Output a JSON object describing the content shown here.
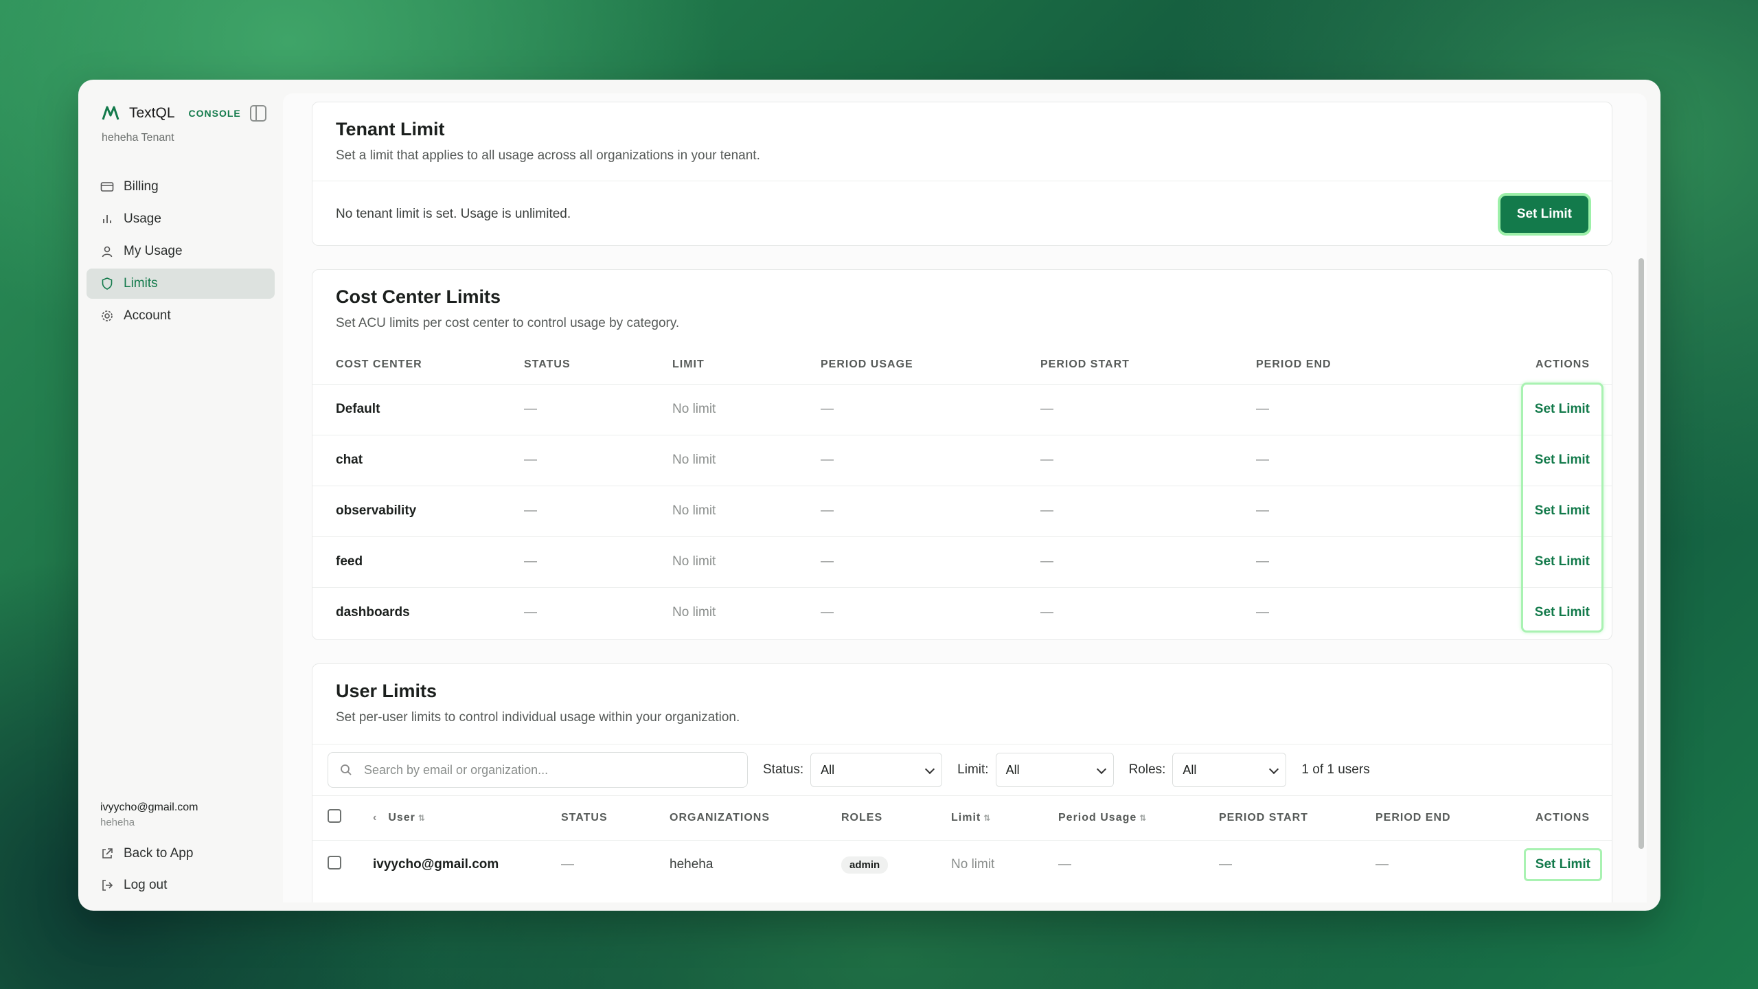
{
  "sidebar": {
    "brand": "TextQL",
    "console": "CONSOLE",
    "tenant": "heheha Tenant",
    "nav": [
      {
        "label": "Billing",
        "icon": "credit-card-icon"
      },
      {
        "label": "Usage",
        "icon": "bar-chart-icon"
      },
      {
        "label": "My Usage",
        "icon": "user-icon"
      },
      {
        "label": "Limits",
        "icon": "shield-icon",
        "active": true
      },
      {
        "label": "Account",
        "icon": "gear-icon"
      }
    ],
    "user_email": "ivyycho@gmail.com",
    "user_org": "heheha",
    "back_to_app": "Back to App",
    "logout": "Log out"
  },
  "tenant_limit": {
    "title": "Tenant Limit",
    "subtitle": "Set a limit that applies to all usage across all organizations in your tenant.",
    "status": "No tenant limit is set. Usage is unlimited.",
    "button": "Set Limit"
  },
  "cost_center": {
    "title": "Cost Center Limits",
    "subtitle": "Set ACU limits per cost center to control usage by category.",
    "headers": [
      "COST CENTER",
      "STATUS",
      "LIMIT",
      "PERIOD USAGE",
      "PERIOD START",
      "PERIOD END",
      "ACTIONS"
    ],
    "rows": [
      {
        "name": "Default",
        "status": "—",
        "limit": "No limit",
        "usage": "—",
        "start": "—",
        "end": "—",
        "action": "Set Limit"
      },
      {
        "name": "chat",
        "status": "—",
        "limit": "No limit",
        "usage": "—",
        "start": "—",
        "end": "—",
        "action": "Set Limit"
      },
      {
        "name": "observability",
        "status": "—",
        "limit": "No limit",
        "usage": "—",
        "start": "—",
        "end": "—",
        "action": "Set Limit"
      },
      {
        "name": "feed",
        "status": "—",
        "limit": "No limit",
        "usage": "—",
        "start": "—",
        "end": "—",
        "action": "Set Limit"
      },
      {
        "name": "dashboards",
        "status": "—",
        "limit": "No limit",
        "usage": "—",
        "start": "—",
        "end": "—",
        "action": "Set Limit"
      }
    ]
  },
  "user_limits": {
    "title": "User Limits",
    "subtitle": "Set per-user limits to control individual usage within your organization.",
    "search_placeholder": "Search by email or organization...",
    "status_label": "Status:",
    "status_value": "All",
    "limit_label": "Limit:",
    "limit_value": "All",
    "roles_label": "Roles:",
    "roles_value": "All",
    "count": "1 of 1 users",
    "headers": {
      "user": "User",
      "status": "STATUS",
      "orgs": "ORGANIZATIONS",
      "roles": "ROLES",
      "limit": "Limit",
      "usage": "Period Usage",
      "start": "PERIOD START",
      "end": "PERIOD END",
      "actions": "ACTIONS"
    },
    "rows": [
      {
        "email": "ivyycho@gmail.com",
        "status": "—",
        "org": "heheha",
        "role": "admin",
        "limit": "No limit",
        "usage": "—",
        "start": "—",
        "end": "—",
        "action": "Set Limit"
      }
    ]
  }
}
